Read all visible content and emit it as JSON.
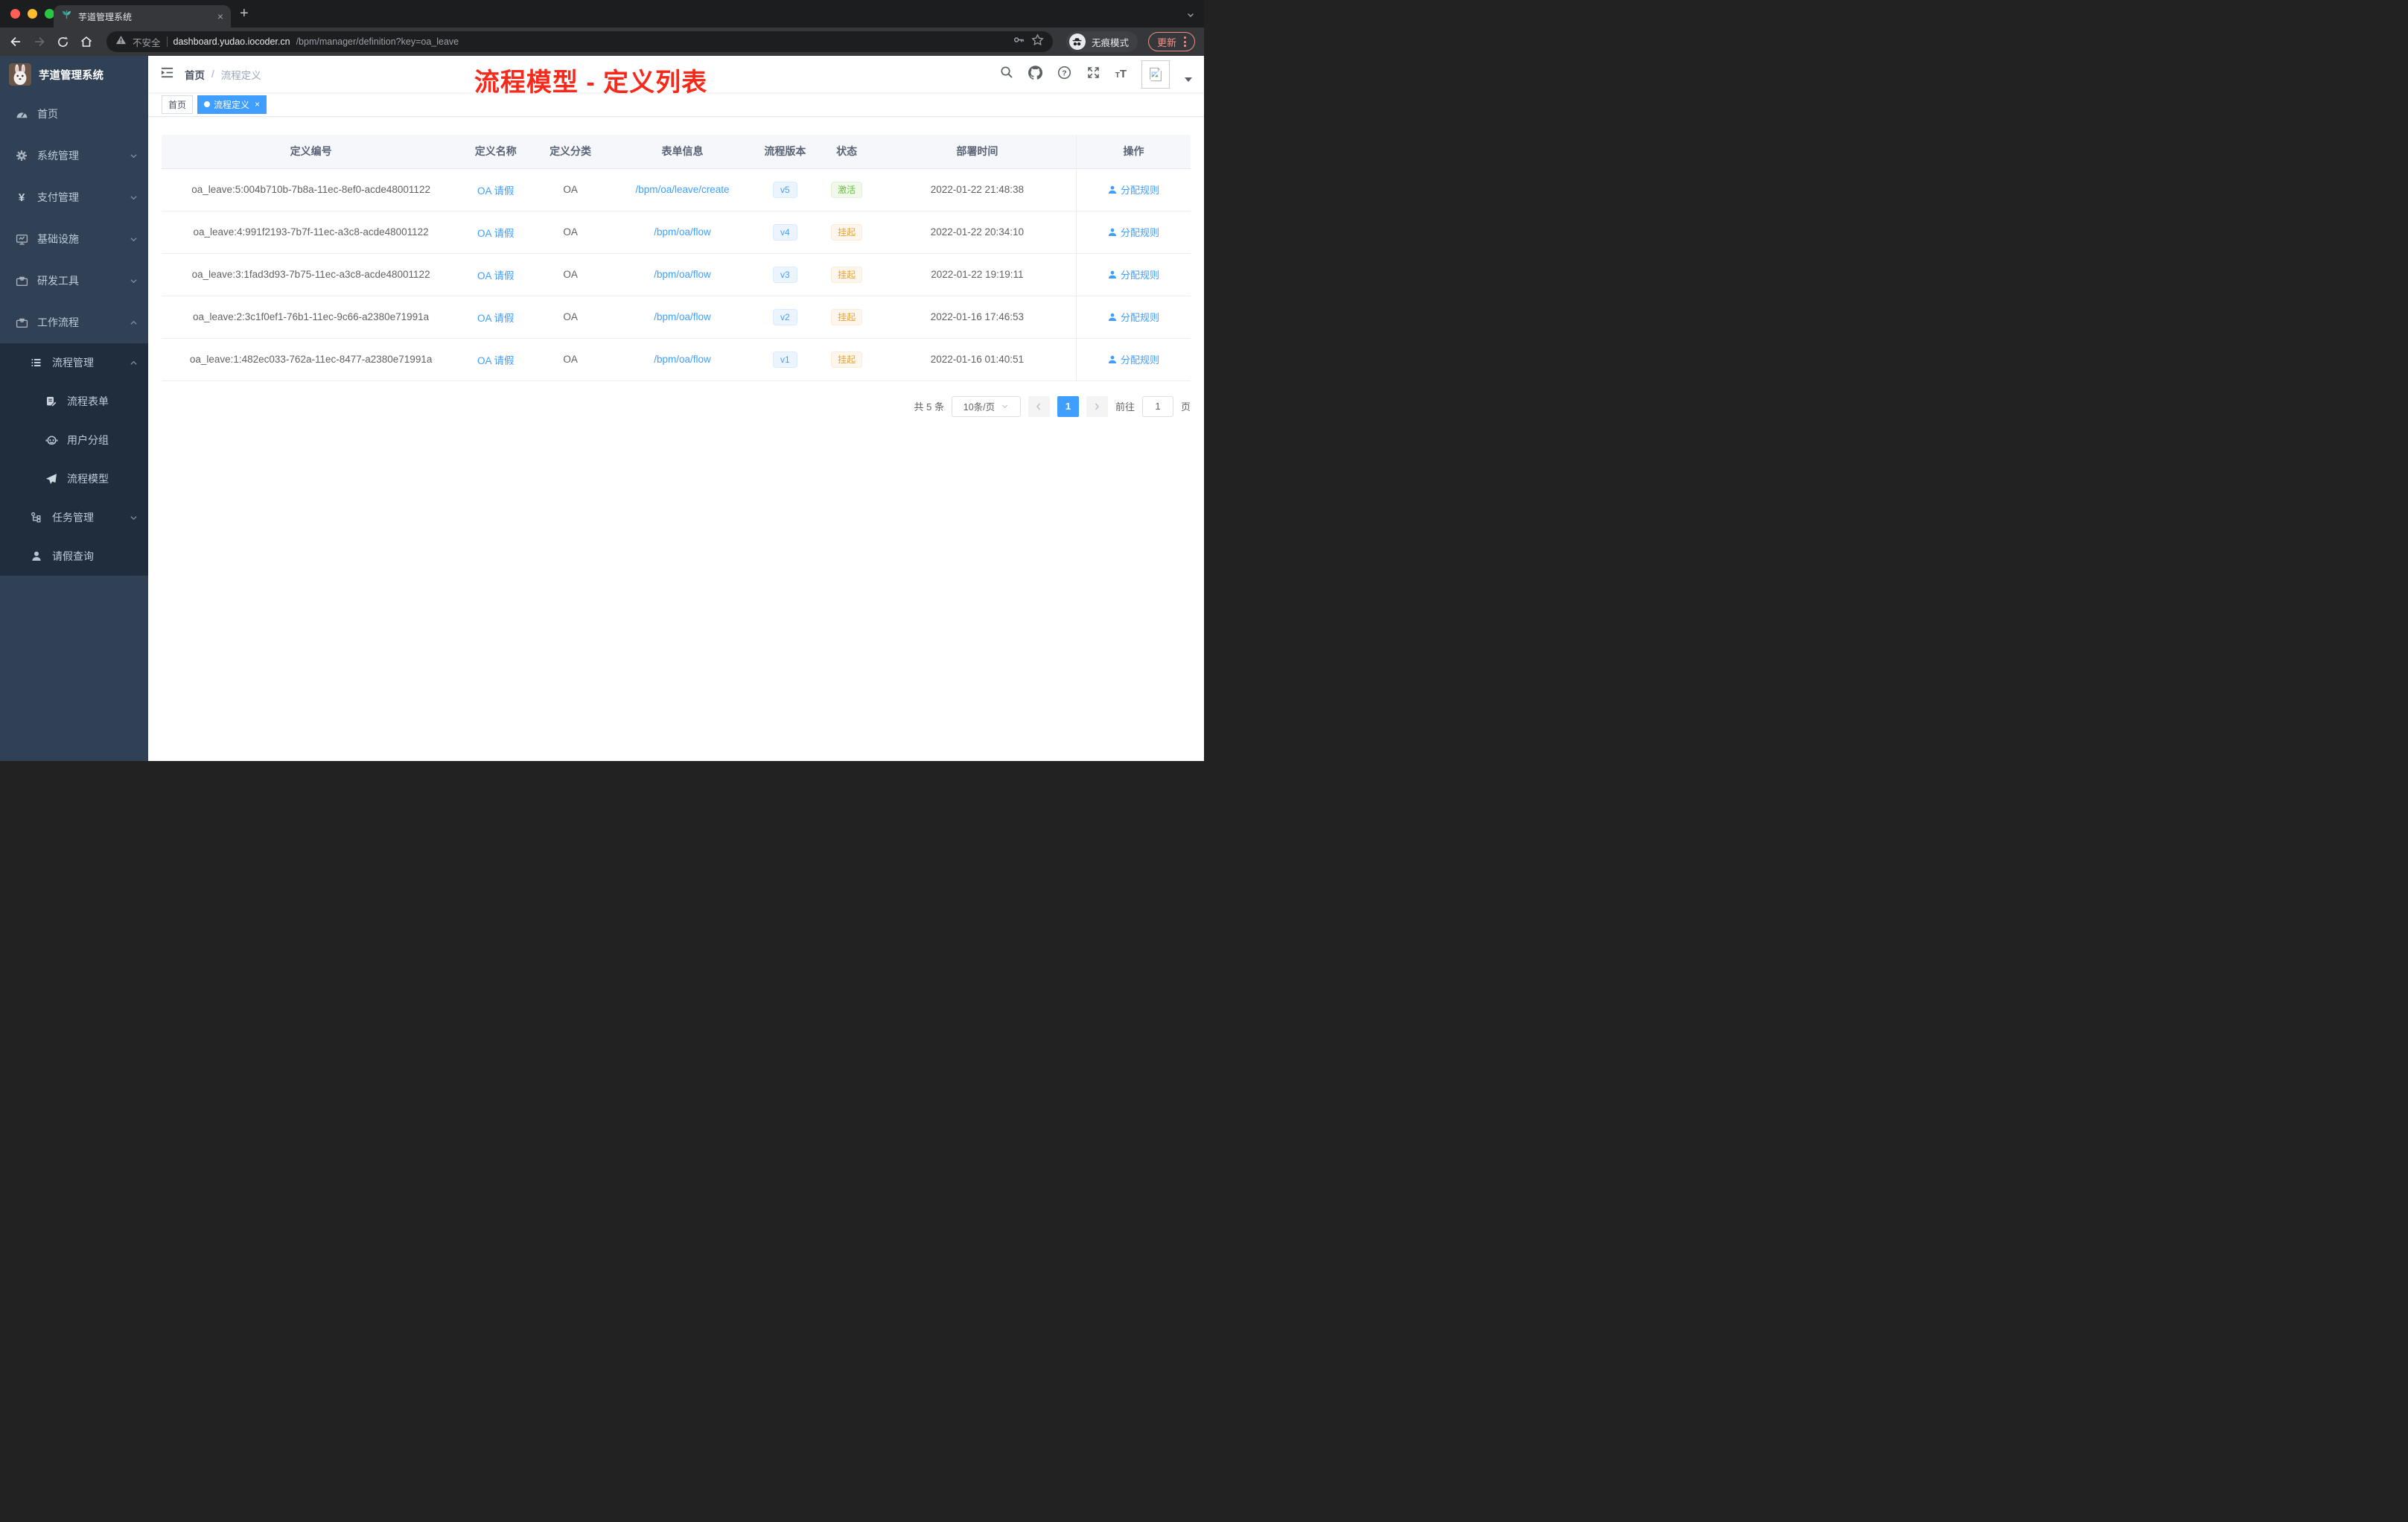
{
  "browser": {
    "tab_title": "芋道管理系统",
    "new_tab_button": "+",
    "tab_close": "×",
    "security_label": "不安全",
    "url_host": "dashboard.yudao.iocoder.cn",
    "url_path": "/bpm/manager/definition?key=oa_leave",
    "incognito_label": "无痕模式",
    "update_button": "更新"
  },
  "sidebar": {
    "app_title": "芋道管理系统",
    "menu": {
      "home": "首页",
      "system": "系统管理",
      "payment": "支付管理",
      "infrastructure": "基础设施",
      "dev_tools": "研发工具",
      "workflow": "工作流程",
      "process_mgmt": "流程管理",
      "process_form": "流程表单",
      "user_group": "用户分组",
      "process_model": "流程模型",
      "task_mgmt": "任务管理",
      "leave_query": "请假查询"
    }
  },
  "header": {
    "breadcrumb_home": "首页",
    "breadcrumb_separator": "/",
    "breadcrumb_current": "流程定义",
    "annotation": "流程模型 - 定义列表"
  },
  "tags": {
    "home": "首页",
    "active": "流程定义",
    "close": "×"
  },
  "table": {
    "columns": [
      "定义编号",
      "定义名称",
      "定义分类",
      "表单信息",
      "流程版本",
      "状态",
      "部署时间",
      "操作"
    ],
    "action_label": "分配规则",
    "rows": [
      {
        "id": "oa_leave:5:004b710b-7b8a-11ec-8ef0-acde48001122",
        "name": "OA 请假",
        "category": "OA",
        "form": "/bpm/oa/leave/create",
        "version": "v5",
        "status": "激活",
        "deployed_at": "2022-01-22 21:48:38"
      },
      {
        "id": "oa_leave:4:991f2193-7b7f-11ec-a3c8-acde48001122",
        "name": "OA 请假",
        "category": "OA",
        "form": "/bpm/oa/flow",
        "version": "v4",
        "status": "挂起",
        "deployed_at": "2022-01-22 20:34:10"
      },
      {
        "id": "oa_leave:3:1fad3d93-7b75-11ec-a3c8-acde48001122",
        "name": "OA 请假",
        "category": "OA",
        "form": "/bpm/oa/flow",
        "version": "v3",
        "status": "挂起",
        "deployed_at": "2022-01-22 19:19:11"
      },
      {
        "id": "oa_leave:2:3c1f0ef1-76b1-11ec-9c66-a2380e71991a",
        "name": "OA 请假",
        "category": "OA",
        "form": "/bpm/oa/flow",
        "version": "v2",
        "status": "挂起",
        "deployed_at": "2022-01-16 17:46:53"
      },
      {
        "id": "oa_leave:1:482ec033-762a-11ec-8477-a2380e71991a",
        "name": "OA 请假",
        "category": "OA",
        "form": "/bpm/oa/flow",
        "version": "v1",
        "status": "挂起",
        "deployed_at": "2022-01-16 01:40:51"
      }
    ]
  },
  "pagination": {
    "total": "共 5 条",
    "page_size": "10条/页",
    "current_page": "1",
    "goto_label": "前往",
    "goto_value": "1",
    "page_suffix": "页"
  },
  "colors": {
    "accent_blue": "#409eff",
    "status_active_green": "#67c23a",
    "status_suspended_orange": "#e6a23c",
    "sidebar_bg": "#304156",
    "sidebar_submenu_bg": "#1f2d3d",
    "annotation_red": "#f7291b"
  }
}
